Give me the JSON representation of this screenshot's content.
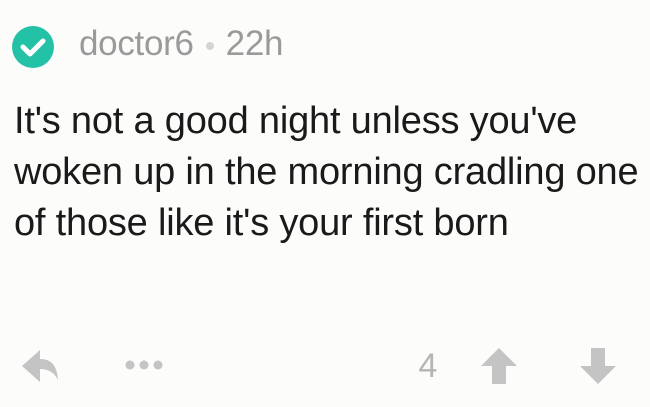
{
  "comment": {
    "author": "doctor6",
    "separator": "•",
    "timestamp": "22h",
    "text": "It's not a good night unless you've woken up in the morning cradling one of those like it's your first born",
    "score": "4"
  },
  "icons": {
    "verified": "verified-check-icon",
    "reply": "reply-arrow-icon",
    "more": "more-dots-icon",
    "upvote": "upvote-arrow-icon",
    "downvote": "downvote-arrow-icon"
  },
  "colors": {
    "verified_badge": "#23c2a6",
    "meta_text": "#9a9a9a",
    "body_text": "#1a1a1a",
    "action_icon": "#c4c4c4",
    "background": "#fcfcfb"
  }
}
